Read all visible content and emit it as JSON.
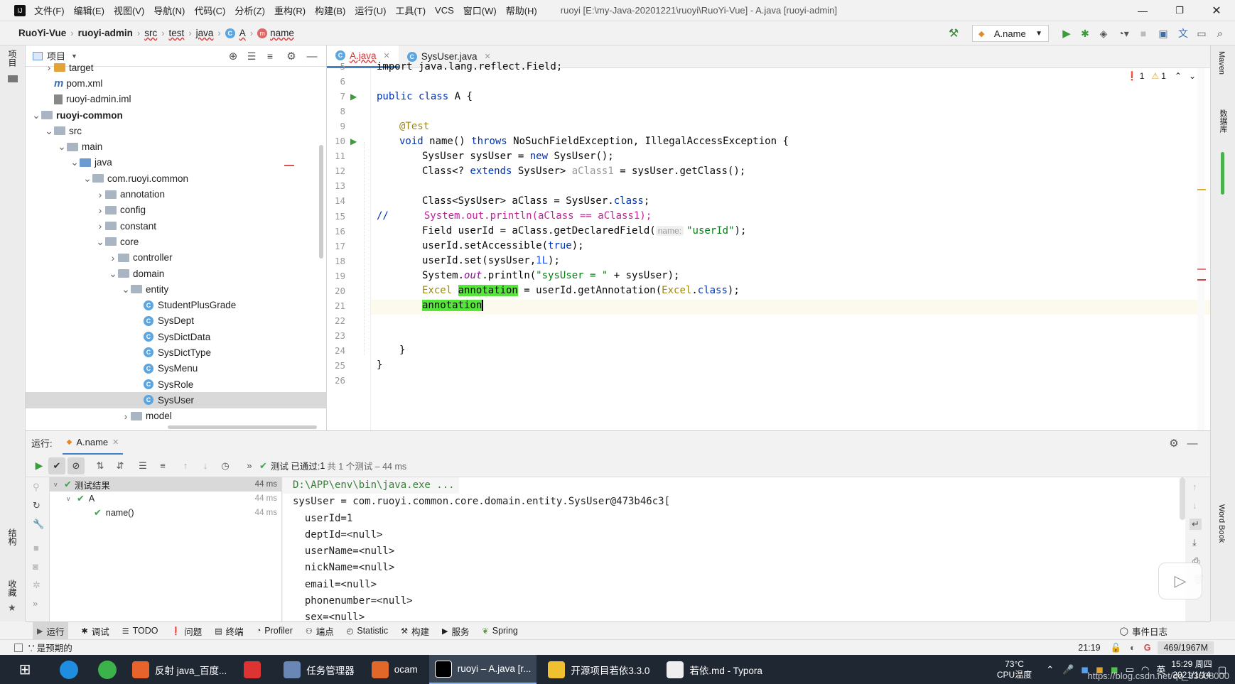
{
  "window": {
    "title": "ruoyi [E:\\my-Java-20201221\\ruoyi\\RuoYi-Vue] - A.java [ruoyi-admin]",
    "menu": [
      "文件(F)",
      "编辑(E)",
      "视图(V)",
      "导航(N)",
      "代码(C)",
      "分析(Z)",
      "重构(R)",
      "构建(B)",
      "运行(U)",
      "工具(T)",
      "VCS",
      "窗口(W)",
      "帮助(H)"
    ]
  },
  "breadcrumb": [
    "RuoYi-Vue",
    "ruoyi-admin",
    "src",
    "test",
    "java",
    "A",
    "name"
  ],
  "run_config": "A.name",
  "left_strip": {
    "project": "项目",
    "structure": "结构",
    "favorites": "收藏"
  },
  "project_panel": {
    "title": "项目",
    "tree": [
      {
        "label": "target",
        "depth": 2,
        "kind": "folder-orange",
        "expand": ">"
      },
      {
        "label": "pom.xml",
        "depth": 2,
        "kind": "maven",
        "expand": ""
      },
      {
        "label": "ruoyi-admin.iml",
        "depth": 2,
        "kind": "file",
        "expand": ""
      },
      {
        "label": "ruoyi-common",
        "depth": 1,
        "kind": "module",
        "expand": "v"
      },
      {
        "label": "src",
        "depth": 2,
        "kind": "folder",
        "expand": "v"
      },
      {
        "label": "main",
        "depth": 3,
        "kind": "folder",
        "expand": "v"
      },
      {
        "label": "java",
        "depth": 4,
        "kind": "folder-blue",
        "expand": "v"
      },
      {
        "label": "com.ruoyi.common",
        "depth": 5,
        "kind": "package",
        "expand": "v"
      },
      {
        "label": "annotation",
        "depth": 6,
        "kind": "package",
        "expand": ">"
      },
      {
        "label": "config",
        "depth": 6,
        "kind": "package",
        "expand": ">"
      },
      {
        "label": "constant",
        "depth": 6,
        "kind": "package",
        "expand": ">"
      },
      {
        "label": "core",
        "depth": 6,
        "kind": "package",
        "expand": "v"
      },
      {
        "label": "controller",
        "depth": 7,
        "kind": "package",
        "expand": ">"
      },
      {
        "label": "domain",
        "depth": 7,
        "kind": "package",
        "expand": "v"
      },
      {
        "label": "entity",
        "depth": 8,
        "kind": "package",
        "expand": "v"
      },
      {
        "label": "StudentPlusGrade",
        "depth": 9,
        "kind": "class",
        "expand": ""
      },
      {
        "label": "SysDept",
        "depth": 9,
        "kind": "class",
        "expand": ""
      },
      {
        "label": "SysDictData",
        "depth": 9,
        "kind": "class",
        "expand": ""
      },
      {
        "label": "SysDictType",
        "depth": 9,
        "kind": "class",
        "expand": ""
      },
      {
        "label": "SysMenu",
        "depth": 9,
        "kind": "class",
        "expand": ""
      },
      {
        "label": "SysRole",
        "depth": 9,
        "kind": "class",
        "expand": ""
      },
      {
        "label": "SysUser",
        "depth": 9,
        "kind": "class",
        "expand": "",
        "selected": true
      },
      {
        "label": "model",
        "depth": 8,
        "kind": "package",
        "expand": ">"
      }
    ]
  },
  "editor": {
    "tabs": [
      {
        "label": "A.java",
        "active": true
      },
      {
        "label": "SysUser.java",
        "active": false
      }
    ],
    "inspections": {
      "errors": "1",
      "warnings": "1"
    },
    "line_numbers": [
      "5",
      "6",
      "7",
      "8",
      "9",
      "10",
      "11",
      "12",
      "13",
      "14",
      "15",
      "16",
      "17",
      "18",
      "19",
      "20",
      "21",
      "22",
      "23",
      "24",
      "25",
      "26"
    ],
    "code": {
      "l5": "import java.lang.reflect.Field;",
      "l7a": "public class",
      "l7b": " A {",
      "l9": "@Test",
      "l10a": "void",
      "l10b": " name() ",
      "l10c": "throws",
      "l10d": " NoSuchFieldException, IllegalAccessException {",
      "l11a": "SysUser sysUser = ",
      "l11b": "new",
      "l11c": " SysUser();",
      "l12a": "Class<? ",
      "l12b": "extends",
      "l12c": " SysUser> ",
      "l12d": "aClass1",
      "l12e": " = sysUser.getClass();",
      "l14a": "Class<SysUser> aClass = SysUser.",
      "l14b": "class",
      "l14c": ";",
      "l15a": "//",
      "l15b": "System.out.println(aClass == aClass1);",
      "l16a": "Field userId = aClass.getDeclaredField(",
      "l16hint": "name:",
      "l16b": "\"userId\"",
      "l16c": ");",
      "l17a": "userId.setAccessible(",
      "l17b": "true",
      "l17c": ");",
      "l18a": "userId.set(sysUser,",
      "l18b": "1L",
      "l18c": ");",
      "l19a": "System.",
      "l19b": "out",
      "l19c": ".println(",
      "l19d": "\"sysUser = \"",
      "l19e": " + sysUser);",
      "l20a": "Excel ",
      "l20b": "annotation",
      "l20c": " = userId.getAnnotation(",
      "l20d": "Excel",
      "l20e": ".",
      "l20f": "class",
      "l20g": ");",
      "l21": "annotation",
      "l24": "}",
      "l25": "}"
    }
  },
  "run_panel": {
    "label": "运行:",
    "tab": "A.name",
    "status_prefix": "测试 已通过:",
    "status_count": "1",
    "status_suffix": "共 1 个测试 – 44 ms",
    "tree": [
      {
        "label": "测试结果",
        "time": "44 ms"
      },
      {
        "label": "A",
        "time": "44 ms"
      },
      {
        "label": "name()",
        "time": "44 ms"
      }
    ],
    "console": [
      "D:\\APP\\env\\bin\\java.exe ...",
      "sysUser = com.ruoyi.common.core.domain.entity.SysUser@473b46c3[",
      "  userId=1",
      "  deptId=<null>",
      "  userName=<null>",
      "  nickName=<null>",
      "  email=<null>",
      "  phonenumber=<null>",
      "  sex=<null>"
    ]
  },
  "bottom_tools": [
    "运行",
    "调试",
    "TODO",
    "问题",
    "终端",
    "Profiler",
    "端点",
    "Statistic",
    "构建",
    "服务",
    "Spring"
  ],
  "event_log": "事件日志",
  "status": {
    "message": "'.' 是预期的",
    "position": "21:19",
    "memory": "469/1967M"
  },
  "right_strip": {
    "maven": "Maven",
    "database": "数据库",
    "wordbook": "Word Book"
  },
  "taskbar": {
    "items": [
      {
        "label": "反射 java_百度...",
        "color": "#e8622c"
      },
      {
        "label": "",
        "color": "#d33"
      },
      {
        "label": "任务管理器",
        "color": "#6a86b5"
      },
      {
        "label": "ocam",
        "color": "#e2672b"
      },
      {
        "label": "ruoyi – A.java [r...",
        "color": "#000"
      },
      {
        "label": "开源项目若依3.3.0",
        "color": "#f0c030"
      },
      {
        "label": "若依.md - Typora",
        "color": "#eee"
      }
    ],
    "temp": "73°C",
    "cpu": "CPU温度",
    "time": "15:29 周四",
    "date": "2021/1/14",
    "watermark": "https://blog.csdn.net/qq_33608000"
  }
}
